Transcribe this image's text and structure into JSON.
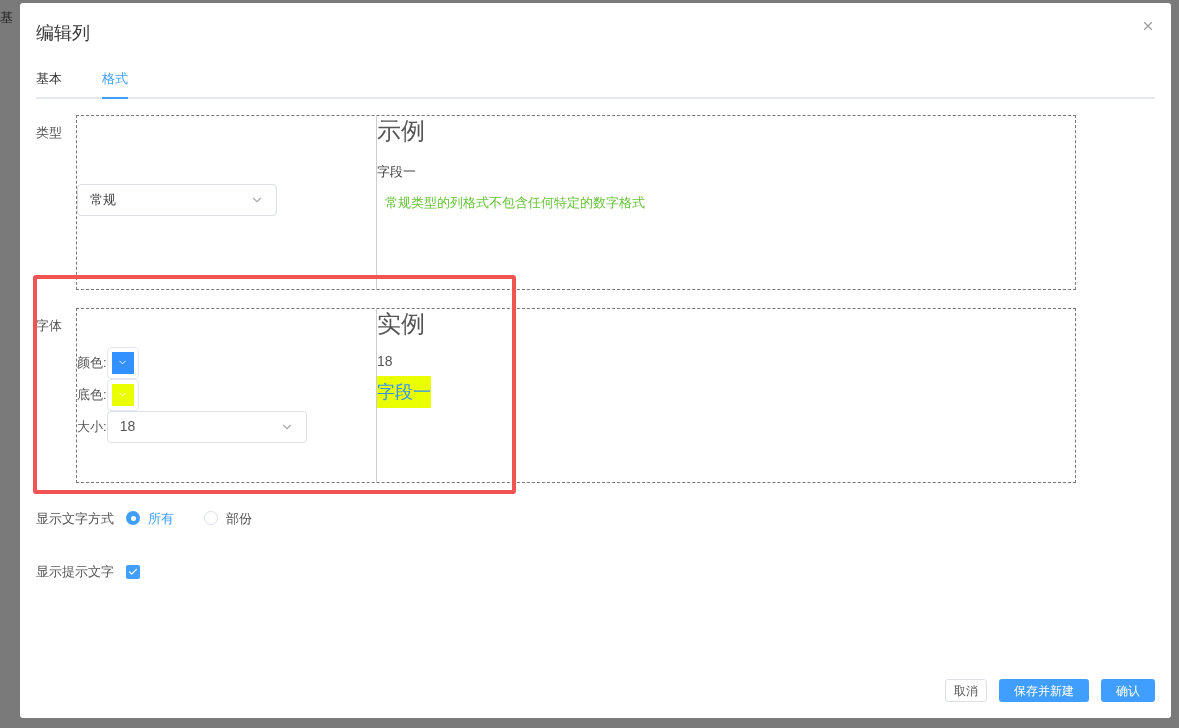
{
  "background": {
    "text": "基"
  },
  "dialog": {
    "title": "编辑列",
    "tabs": [
      {
        "label": "基本",
        "selected": false
      },
      {
        "label": "格式",
        "selected": true
      }
    ],
    "type_section": {
      "label": "类型",
      "select_value": "常规",
      "preview_title": "示例",
      "preview_field": "字段一",
      "description": "常规类型的列格式不包含任何特定的数字格式"
    },
    "font_section": {
      "label": "字体",
      "pickers": [
        {
          "label": "颜色:",
          "color": "#3290ff"
        },
        {
          "label": "底色:",
          "color": "#eaff00"
        }
      ],
      "size_label": "大小:",
      "size_value": "18",
      "preview_title": "实例",
      "preview_size": "18",
      "preview_field": "字段一"
    },
    "display_mode": {
      "label": "显示文字方式",
      "options": [
        {
          "label": "所有",
          "selected": true
        },
        {
          "label": "部份",
          "selected": false
        }
      ]
    },
    "show_tooltip": {
      "label": "显示提示文字",
      "checked": true
    },
    "buttons": [
      {
        "label": "取消",
        "kind": "default"
      },
      {
        "label": "保存并新建",
        "kind": "primary"
      },
      {
        "label": "确认",
        "kind": "primary"
      }
    ]
  }
}
